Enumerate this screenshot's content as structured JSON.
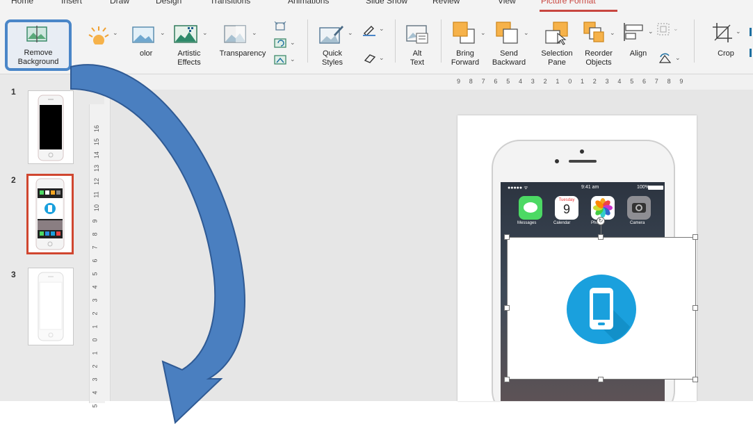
{
  "tabs": [
    "Home",
    "Insert",
    "Draw",
    "Design",
    "Transitions",
    "Animations",
    "Slide Show",
    "Review",
    "View",
    "Picture Format"
  ],
  "active_tab": "Picture Format",
  "ribbon": {
    "remove_background": [
      "Remove",
      "Background"
    ],
    "color": "olor",
    "artistic_effects": [
      "Artistic",
      "Effects"
    ],
    "transparency": "Transparency",
    "quick_styles": [
      "Quick",
      "Styles"
    ],
    "alt_text": [
      "Alt",
      "Text"
    ],
    "bring_forward": [
      "Bring",
      "Forward"
    ],
    "send_backward": [
      "Send",
      "Backward"
    ],
    "selection_pane": [
      "Selection",
      "Pane"
    ],
    "reorder_objects": [
      "Reorder",
      "Objects"
    ],
    "align": "Align",
    "crop": "Crop"
  },
  "slides": [
    {
      "number": "1"
    },
    {
      "number": "2"
    },
    {
      "number": "3"
    }
  ],
  "selected_slide": "2",
  "ruler": {
    "horizontal": [
      "9",
      "8",
      "7",
      "6",
      "5",
      "4",
      "3",
      "2",
      "1",
      "0",
      "1",
      "2",
      "3",
      "4",
      "5",
      "6",
      "7",
      "8",
      "9"
    ],
    "vertical": [
      "16",
      "15",
      "14",
      "13",
      "12",
      "11",
      "10",
      "9",
      "8",
      "7",
      "6",
      "5",
      "4",
      "3",
      "2",
      "1",
      "0",
      "1",
      "2",
      "3",
      "4",
      "5"
    ]
  },
  "phone_screen": {
    "status_carrier": "●●●●● ᯤ",
    "status_time": "9:41 am",
    "status_battery": "100%",
    "calendar_day": "Tuesday",
    "calendar_date": "9",
    "app_labels": [
      "Messages",
      "Calendar",
      "Photos",
      "Camera"
    ]
  },
  "colors": {
    "accent_tab": "#c8463f",
    "highlight_box": "#4a86c8",
    "arrow": "#4a7fc0",
    "selected_slide_border": "#d0462f",
    "phone_icon_circle": "#1aa0dd"
  }
}
